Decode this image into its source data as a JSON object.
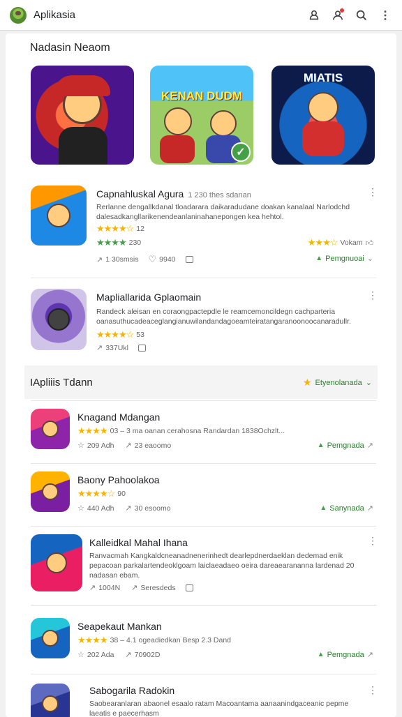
{
  "app": {
    "title": "Aplikasia"
  },
  "colors": {
    "accent": "#2e7d32",
    "star": "#f5b400",
    "notification": "#e53935"
  },
  "featured": {
    "title": "Nadasin Neaom",
    "banners": [
      {
        "label": "",
        "icon": "character-art-icon"
      },
      {
        "label": "KENAN DUDM",
        "icon": "character-art-icon",
        "badge": "✓"
      },
      {
        "label": "MIATIS",
        "icon": "character-art-icon"
      }
    ]
  },
  "apps_top": [
    {
      "name": "Capnahluskal Agura",
      "sub": "1 230 thes sdanan",
      "desc": "Rerlanne dengallkdanal tloadarara daikaradudane doakan kanalaal Narlodchd dalesadkangllarikenendeanlaninahanepongen kea hehtol.",
      "rating1": "12",
      "rating2": "230",
      "rating_right": "Vokam",
      "stat1": "1 30smsis",
      "stat2": "9940",
      "install": "Pemgnuoai"
    },
    {
      "name": "Mapliallarida Gplaomain",
      "sub": "",
      "desc": "Randeck aleisan en coraongpactepdle le reamcemoncildegn cachparteria oanasuthucadeaceglangianuwilandandagoeamteiratangaranoonoocanaradullr.",
      "rating1": "53",
      "stat1": "337Ukl",
      "install": ""
    }
  ],
  "section": {
    "title": "IApliiis Tdann",
    "filter": "Etyenolanada"
  },
  "apps_list": [
    {
      "name": "Knagand Mdangan",
      "line": "03 – 3 ma oanan cerahosna Randardan 1838Ochzlt...",
      "stat1": "209 Adh",
      "stat2": "23 eaoomo",
      "install": "Pemgnada"
    },
    {
      "name": "Baony Pahoolakoa",
      "line": "90",
      "stat1": "440 Adh",
      "stat2": "30 esoomo",
      "install": "Sanynada"
    },
    {
      "name": "Kalleidkal Mahal Ihana",
      "desc": "Ranvacmah Kangkaldcneanadnenerinhedt dearlepdnerdaeklan dedemad enik pepacoan parkalartendeoklgoam laiclaeadaeo oeira dareaearananna lardenad 20 nadasan ebam.",
      "stat1": "1004N",
      "stat2": "Seresdeds"
    },
    {
      "name": "Seapekaut Mankan",
      "line": "38 – 4.1 ogeadiedkan Besp 2.3 Dand",
      "stat1": "202 Ada",
      "stat2": "70902D",
      "install": "Pemgnada"
    },
    {
      "name": "Sabogarila Radokin",
      "desc": "Saobearanlaran abaonel esaalo ratam Macoantama aanaanindgaceanic pepme laeatis e paecerhasm aicoaalaarkaneteraalaataimalanaceutbanintenanaaonsamadaoe."
    }
  ]
}
